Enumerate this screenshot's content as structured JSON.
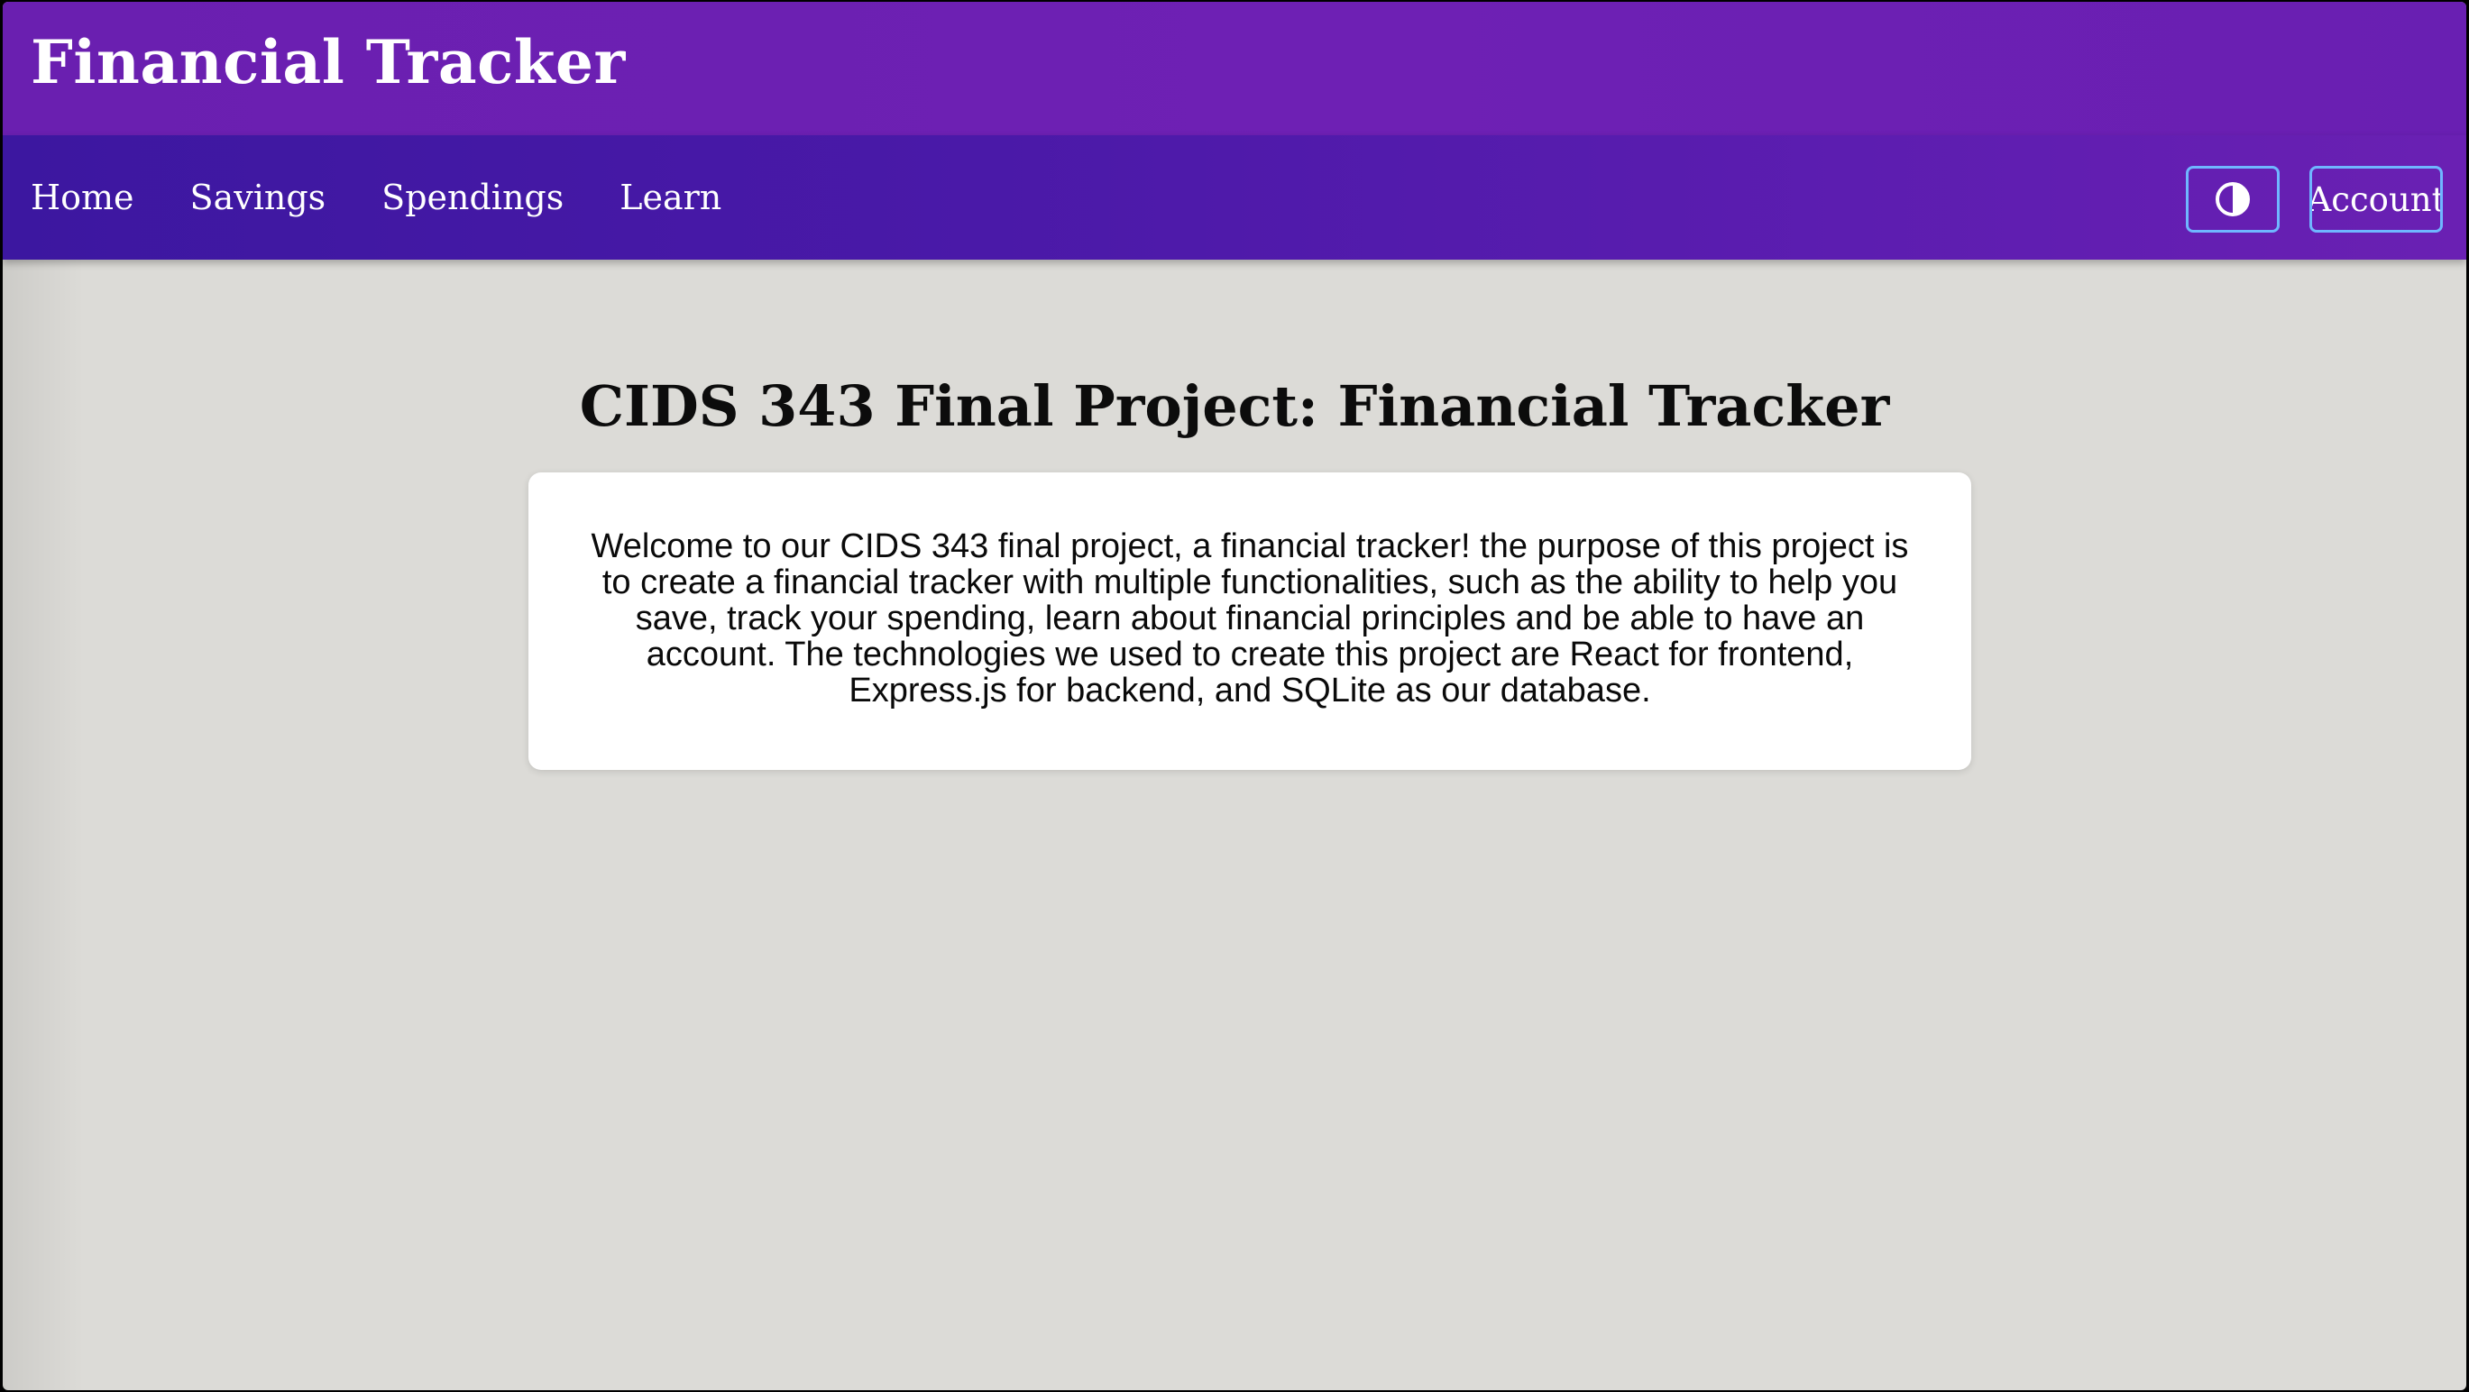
{
  "app": {
    "title": "Financial Tracker"
  },
  "nav": {
    "links": [
      {
        "label": "Home"
      },
      {
        "label": "Savings"
      },
      {
        "label": "Spendings"
      },
      {
        "label": "Learn"
      }
    ],
    "theme_toggle_icon": "contrast-icon",
    "account_label": "Account"
  },
  "main": {
    "heading": "CIDS 343 Final Project: Financial Tracker",
    "intro": "Welcome to our CIDS 343 final project, a financial tracker! the purpose of this project is to create a financial tracker with multiple functionalities, such as the ability to help you save, track your spending, learn about financial principles and be able to have an account. The technologies we used to create this project are React for frontend, Express.js for backend, and SQLite as our database."
  },
  "colors": {
    "title_bar": "#6a1fb0",
    "nav_bar_start": "#3c17a0",
    "nav_bar_end": "#6a20b3",
    "button_border": "#6fb6ff",
    "page_background": "#dcdbd7",
    "card_background": "#ffffff"
  }
}
